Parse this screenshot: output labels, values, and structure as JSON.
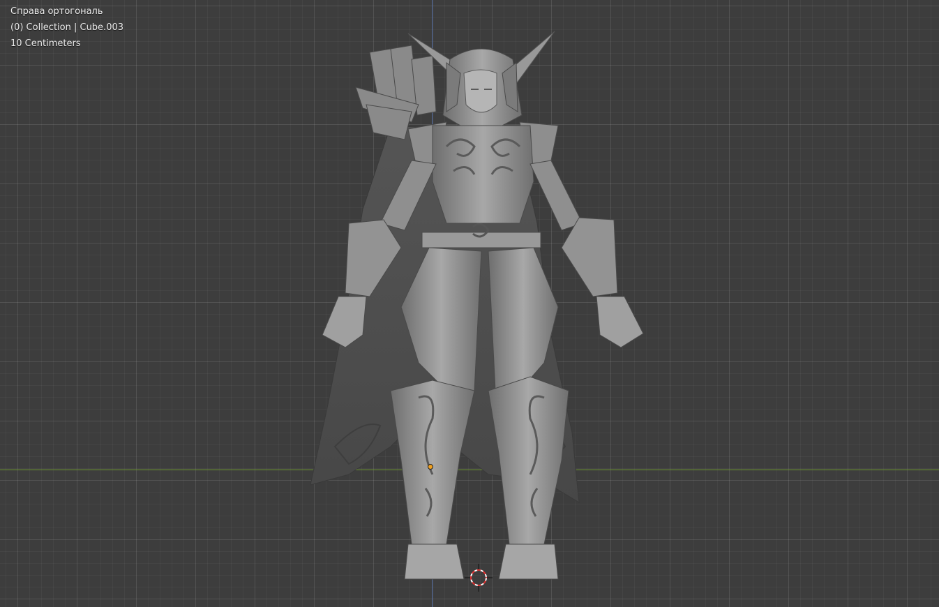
{
  "viewport": {
    "view_name": "Справа ортогональ",
    "collection_info": "(0) Collection | Cube.003",
    "grid_scale": "10 Centimeters"
  },
  "colors": {
    "background": "#3d3d3d",
    "axis_x": "#6f9a2e",
    "axis_y": "#4a6aa8",
    "model": "#8c8c8c",
    "origin": "#f0a020"
  },
  "icons": {
    "cursor": "3d-cursor-icon",
    "origin": "object-origin-icon"
  }
}
